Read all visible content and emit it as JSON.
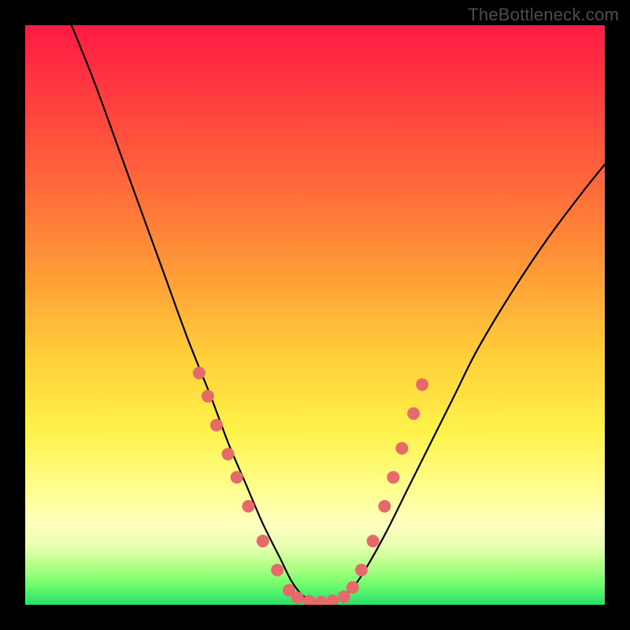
{
  "watermark": "TheBottleneck.com",
  "chart_data": {
    "type": "line",
    "title": "",
    "xlabel": "",
    "ylabel": "",
    "xlim": [
      0,
      100
    ],
    "ylim": [
      0,
      100
    ],
    "grid": false,
    "background_gradient": {
      "direction": "vertical",
      "stops": [
        {
          "pos": 0,
          "color": "#ff1a44"
        },
        {
          "pos": 12,
          "color": "#ff3c3f"
        },
        {
          "pos": 28,
          "color": "#ff6a3a"
        },
        {
          "pos": 44,
          "color": "#ffa037"
        },
        {
          "pos": 58,
          "color": "#ffd23a"
        },
        {
          "pos": 70,
          "color": "#fff24a"
        },
        {
          "pos": 80,
          "color": "#ffff8f"
        },
        {
          "pos": 86,
          "color": "#ffffbf"
        },
        {
          "pos": 90,
          "color": "#e8ffb0"
        },
        {
          "pos": 93,
          "color": "#b8ff89"
        },
        {
          "pos": 96,
          "color": "#7bff6f"
        },
        {
          "pos": 100,
          "color": "#26e06a"
        }
      ]
    },
    "series": [
      {
        "name": "bottleneck-curve",
        "color": "#000000",
        "x": [
          8,
          12,
          16,
          20,
          24,
          28,
          32,
          35,
          38,
          41,
          44,
          46,
          48,
          50,
          52,
          54,
          56,
          58,
          62,
          66,
          70,
          74,
          78,
          84,
          90,
          96,
          100
        ],
        "y": [
          100,
          90,
          79,
          68,
          57,
          46,
          36,
          28,
          21,
          14,
          8,
          4,
          1.5,
          0.5,
          0.5,
          1,
          2.5,
          5,
          12,
          20,
          28,
          36,
          44,
          54,
          63,
          71,
          76
        ]
      }
    ],
    "markers": {
      "color": "#e66a6a",
      "radius": 8,
      "points": [
        {
          "x": 30.0,
          "y": 40
        },
        {
          "x": 31.5,
          "y": 36
        },
        {
          "x": 33.0,
          "y": 31
        },
        {
          "x": 35.0,
          "y": 26
        },
        {
          "x": 36.5,
          "y": 22
        },
        {
          "x": 38.5,
          "y": 17
        },
        {
          "x": 41.0,
          "y": 11
        },
        {
          "x": 43.5,
          "y": 6
        },
        {
          "x": 45.5,
          "y": 2.5
        },
        {
          "x": 47.0,
          "y": 1.2
        },
        {
          "x": 49.0,
          "y": 0.6
        },
        {
          "x": 51.0,
          "y": 0.5
        },
        {
          "x": 53.0,
          "y": 0.7
        },
        {
          "x": 55.0,
          "y": 1.4
        },
        {
          "x": 56.5,
          "y": 3
        },
        {
          "x": 58.0,
          "y": 6
        },
        {
          "x": 60.0,
          "y": 11
        },
        {
          "x": 62.0,
          "y": 17
        },
        {
          "x": 63.5,
          "y": 22
        },
        {
          "x": 65.0,
          "y": 27
        },
        {
          "x": 67.0,
          "y": 33
        },
        {
          "x": 68.5,
          "y": 38
        }
      ]
    }
  }
}
